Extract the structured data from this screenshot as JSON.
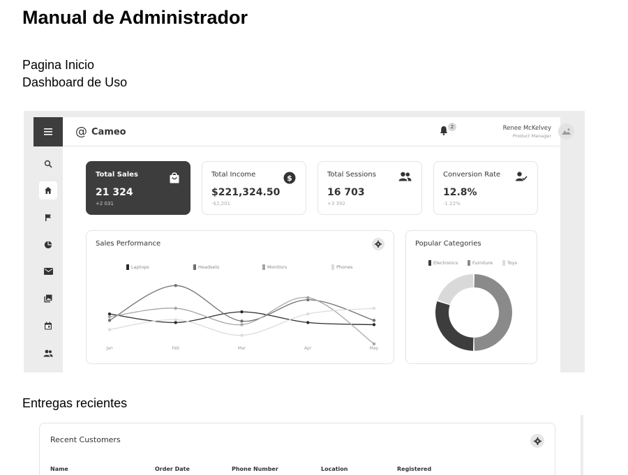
{
  "document": {
    "title": "Manual de Administrador",
    "line1": "Pagina Inicio",
    "line2": "Dashboard de Uso",
    "section2": "Entregas recientes"
  },
  "app": {
    "brand": "Cameo",
    "notification_count": "2",
    "user": {
      "name": "Renee McKelvey",
      "role": "Product Manager"
    },
    "sidebar": [
      "menu-icon",
      "search-icon",
      "home-icon",
      "flag-icon",
      "pie-chart-icon",
      "mail-icon",
      "gallery-icon",
      "calendar-icon",
      "people-icon"
    ],
    "stats": [
      {
        "title": "Total Sales",
        "value": "21 324",
        "sub": "+2 031",
        "icon": "shopping-bag-icon"
      },
      {
        "title": "Total Income",
        "value": "$221,324.50",
        "sub": "-$2,201",
        "icon": "dollar-icon"
      },
      {
        "title": "Total Sessions",
        "value": "16 703",
        "sub": "+3 392",
        "icon": "users-icon"
      },
      {
        "title": "Conversion Rate",
        "value": "12.8%",
        "sub": "-1.22%",
        "icon": "user-check-icon"
      }
    ],
    "sales_performance": {
      "title": "Sales Performance"
    },
    "popular_categories": {
      "title": "Popular Categories"
    }
  },
  "recent_customers": {
    "title": "Recent Customers",
    "columns": [
      "Name",
      "Order Date",
      "Phone Number",
      "Location",
      "Registered"
    ]
  },
  "colors": {
    "dark": "#3d3d3d",
    "mid": "#8a8a8a",
    "light": "#d9d9d9",
    "series_laptops": "#2b2b2b",
    "series_headsets": "#6f6f6f",
    "series_monitors": "#a5a5a5",
    "series_phones": "#dcdcdc"
  },
  "chart_data": [
    {
      "type": "line",
      "title": "Sales Performance",
      "categories": [
        "Jan",
        "Feb",
        "Mar",
        "Apr",
        "May"
      ],
      "ylim": [
        0,
        100
      ],
      "legend": "top",
      "grid": false,
      "series": [
        {
          "name": "Laptops",
          "values": [
            42,
            30,
            45,
            30,
            27
          ]
        },
        {
          "name": "Headsets",
          "values": [
            33,
            82,
            32,
            62,
            33
          ]
        },
        {
          "name": "Monitors",
          "values": [
            38,
            50,
            27,
            65,
            0
          ]
        },
        {
          "name": "Phones",
          "values": [
            20,
            34,
            12,
            42,
            50
          ]
        }
      ]
    },
    {
      "type": "pie",
      "title": "Popular Categories",
      "legend": "top",
      "categories": [
        "Electronics",
        "Furniture",
        "Toys"
      ],
      "values": [
        30,
        50,
        20
      ]
    }
  ]
}
